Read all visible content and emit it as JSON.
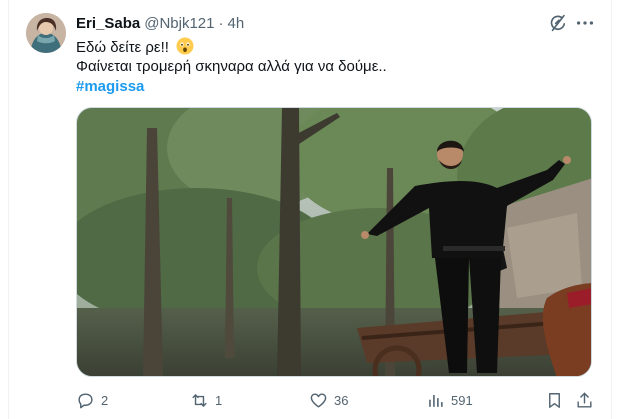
{
  "tweet": {
    "author_name": "Eri_Saba",
    "handle": "@Nbjk121",
    "separator": "·",
    "time": "4h",
    "line1": "Εδώ δείτε ρε!!",
    "line1_emoji": "astonished-face-emoji",
    "line2": "Φαίνεται τρομερή σκηναρα αλλά για να δούμε..",
    "hashtag": "#magissa"
  },
  "actions": {
    "replies": "2",
    "retweets": "1",
    "likes": "36",
    "views": "591"
  },
  "icons": {
    "grok": "grok-icon",
    "more": "more-icon",
    "reply": "reply-icon",
    "retweet": "retweet-icon",
    "like": "heart-icon",
    "views": "views-icon",
    "bookmark": "bookmark-icon",
    "share": "share-icon"
  },
  "colors": {
    "text": "#0f1419",
    "secondary": "#536471",
    "link": "#1d9bf0",
    "border": "#cfd9de"
  }
}
